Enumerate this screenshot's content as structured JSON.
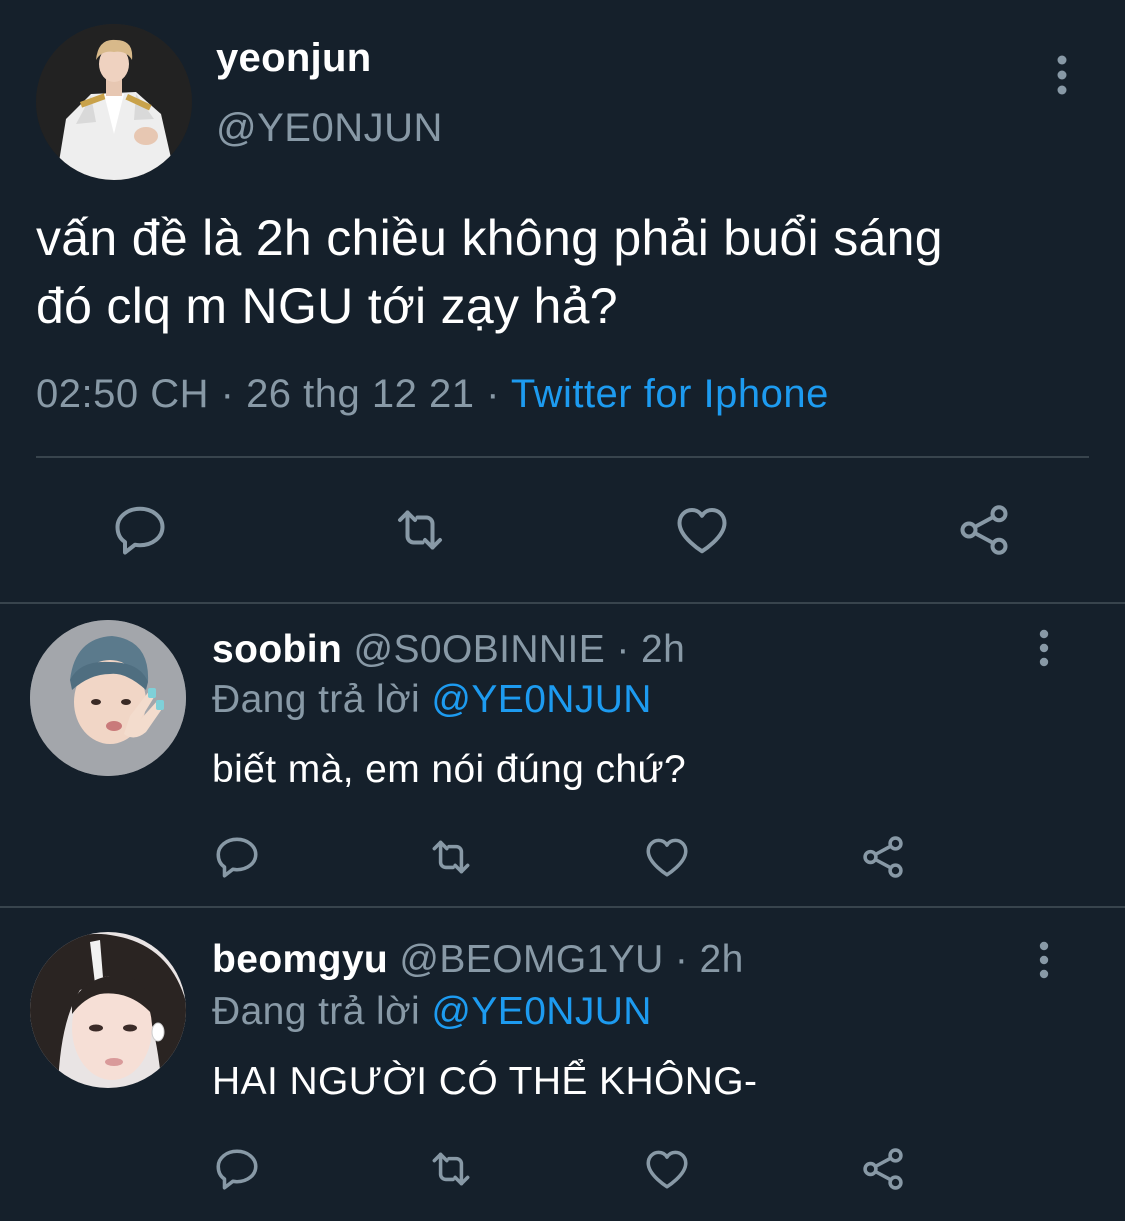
{
  "colors": {
    "background": "#15202b",
    "text": "#ffffff",
    "muted": "#8899a6",
    "accent": "#1d9bf0",
    "divider": "#38444d"
  },
  "main_tweet": {
    "display_name": "yeonjun",
    "handle": "@YE0NJUN",
    "text_line1": "vấn đề là 2h chiều không phải buổi sáng",
    "text_line2": "đó clq m NGU tới zạy hả?",
    "time": "02:50 CH",
    "separator": "·",
    "date": "26 thg 12 21",
    "source": "Twitter for Iphone",
    "icons": [
      "more-vertical-icon",
      "reply-icon",
      "retweet-icon",
      "like-icon",
      "share-icon"
    ]
  },
  "replies": [
    {
      "display_name": "soobin",
      "handle": "@S0OBINNIE",
      "dot": "·",
      "time": "2h",
      "replying_label": "Đang trả lời",
      "replying_to": "@YE0NJUN",
      "text": "biết mà, em nói đúng chứ?"
    },
    {
      "display_name": "beomgyu",
      "handle": "@BEOMG1YU",
      "dot": "·",
      "time": "2h",
      "replying_label": "Đang trả lời",
      "replying_to": "@YE0NJUN",
      "text": "HAI NGƯỜI CÓ THỂ KHÔNG-"
    }
  ]
}
